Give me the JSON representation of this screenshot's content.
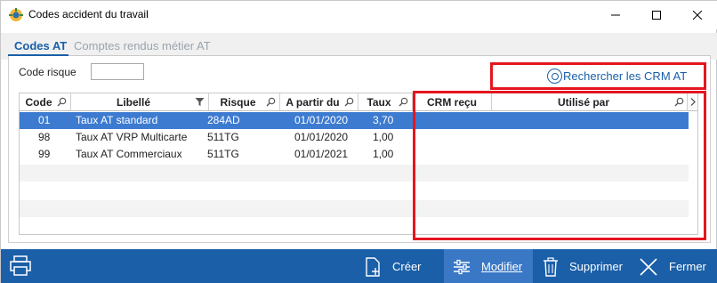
{
  "window": {
    "title": "Codes accident du travail",
    "minimize_icon": "minimize-icon",
    "maximize_icon": "maximize-icon",
    "close_icon": "close-icon"
  },
  "tabs": [
    {
      "label": "Codes AT",
      "active": true
    },
    {
      "label": "Comptes rendus métier AT",
      "active": false
    }
  ],
  "filter": {
    "code_risque_label": "Code risque",
    "code_risque_value": ""
  },
  "crm_link": {
    "label": "Rechercher les CRM AT",
    "icon": "search-circle-icon"
  },
  "table": {
    "columns": [
      "Code",
      "Libellé",
      "Risque",
      "A partir du",
      "Taux",
      "CRM reçu",
      "Utilisé par"
    ],
    "rows": [
      {
        "code": "01",
        "libelle": "Taux AT standard",
        "risque": "284AD",
        "a_partir_du": "01/01/2020",
        "taux": "3,70",
        "crm_recu": "",
        "utilise_par": "",
        "selected": true
      },
      {
        "code": "98",
        "libelle": "Taux AT VRP Multicarte",
        "risque": "511TG",
        "a_partir_du": "01/01/2020",
        "taux": "1,00",
        "crm_recu": "",
        "utilise_par": "",
        "selected": false
      },
      {
        "code": "99",
        "libelle": "Taux AT Commerciaux",
        "risque": "511TG",
        "a_partir_du": "01/01/2021",
        "taux": "1,00",
        "crm_recu": "",
        "utilise_par": "",
        "selected": false
      }
    ]
  },
  "toolbar": {
    "creer": "Créer",
    "modifier": "Modifier",
    "supprimer": "Supprimer",
    "fermer": "Fermer"
  },
  "colors": {
    "accent": "#1a5fa8",
    "selection": "#3d7bd0",
    "highlight_box": "#e4161f"
  }
}
